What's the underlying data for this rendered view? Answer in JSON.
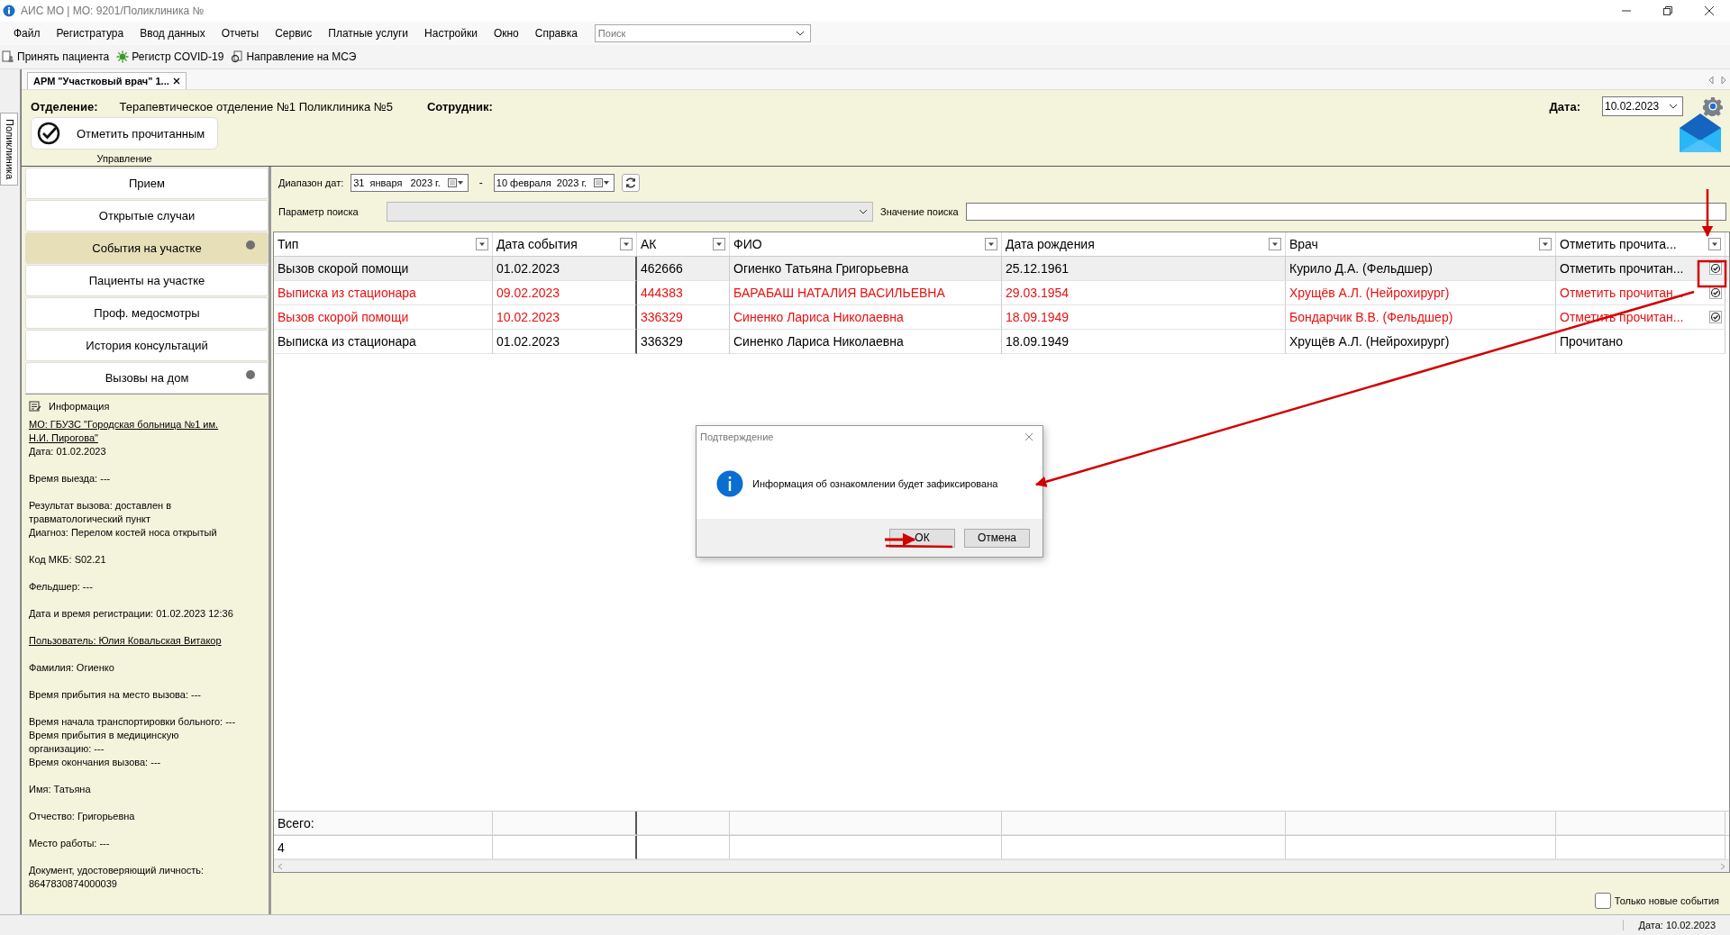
{
  "window": {
    "title": "АИС МО | МО: 9201/Поликлиника №"
  },
  "menu": [
    "Файл",
    "Регистратура",
    "Ввод данных",
    "Отчеты",
    "Сервис",
    "Платные услуги",
    "Настройки",
    "Окно",
    "Справка"
  ],
  "menu_search": {
    "placeholder": "Поиск"
  },
  "toolbar": [
    {
      "label": "Принять пациента",
      "kind": "patient"
    },
    {
      "label": "Регистр COVID-19",
      "kind": "virus"
    },
    {
      "label": "Направление на МСЭ",
      "kind": "referral"
    }
  ],
  "side_tab": "Поликлиника",
  "doc_tab": {
    "label": "АРМ \"Участковый врач\" 1...",
    "selected": true
  },
  "header": {
    "department_label": "Отделение:",
    "department": "Терапевтическое отделение №1 Поликлиника №5",
    "employee_label": "Сотрудник:",
    "date_label": "Дата:",
    "date": "10.02.2023",
    "mark_read_button": "Отметить прочитанным",
    "group_label": "Управление"
  },
  "sidebar": {
    "items": [
      {
        "label": "Прием",
        "selected": false,
        "dot": false
      },
      {
        "label": "Открытые случаи",
        "selected": false,
        "dot": false
      },
      {
        "label": "События на участке",
        "selected": true,
        "dot": true
      },
      {
        "label": "Пациенты на участке",
        "selected": false,
        "dot": false
      },
      {
        "label": "Проф. медосмотры",
        "selected": false,
        "dot": false
      },
      {
        "label": "История консультаций",
        "selected": false,
        "dot": false
      },
      {
        "label": "Вызовы на дом",
        "selected": false,
        "dot": true
      }
    ]
  },
  "info": {
    "title": "Информация",
    "blocks": [
      [
        {
          "text": "МО: ГБУЗС \"Городская больница №1 им. Н.И. Пирогова\"",
          "link": true
        },
        {
          "text": "Дата: 01.02.2023",
          "link": false
        }
      ],
      [
        {
          "text": "Время выезда: ---",
          "link": false
        }
      ],
      [
        {
          "text": "Результат вызова: доставлен в травматологический пункт",
          "link": false
        },
        {
          "text": "Диагноз: Перелом костей носа открытый",
          "link": false
        }
      ],
      [
        {
          "text": "Код МКБ: S02.21",
          "link": false
        }
      ],
      [
        {
          "text": "Фельдшер: ---",
          "link": false
        }
      ],
      [
        {
          "text": "Дата и время регистрации: 01.02.2023 12:36",
          "link": false
        }
      ],
      [
        {
          "text": "Пользователь: Юлия Ковальская Витакор",
          "link": true
        }
      ],
      [
        {
          "text": "Фамилия: Огиенко",
          "link": false
        }
      ],
      [
        {
          "text": "Время прибытия на место вызова: ---",
          "link": false
        }
      ],
      [
        {
          "text": "Время начала транспортировки больного: ---",
          "link": false
        },
        {
          "text": "Время прибытия в медицинскую организацию: ---",
          "link": false
        },
        {
          "text": "Время окончания вызова: ---",
          "link": false
        }
      ],
      [
        {
          "text": "Имя: Татьяна",
          "link": false
        }
      ],
      [
        {
          "text": "Отчество: Григорьевна",
          "link": false
        }
      ],
      [
        {
          "text": "Место работы: ---",
          "link": false
        }
      ],
      [
        {
          "text": "Документ, удостоверяющий личность: 8647830874000039",
          "link": false
        }
      ]
    ]
  },
  "filters": {
    "date_range_label": "Диапазон дат:",
    "date_from": "31  января   2023 г.",
    "date_separator": "-",
    "date_to": "10 февраля  2023 г.",
    "search_param_label": "Параметр поиска",
    "search_value_label": "Значение поиска"
  },
  "table": {
    "columns": [
      "Тип",
      "Дата события",
      "АК",
      "ФИО",
      "Дата рождения",
      "Врач",
      "Отметить  прочита..."
    ],
    "rows": [
      {
        "cells": [
          "Вызов скорой помощи",
          "01.02.2023",
          "462666",
          "Огиенко Татьяна Григорьевна",
          "25.12.1961",
          "Курило Д.А. (Фельдшер)",
          "Отметить  прочитан..."
        ],
        "selected": true,
        "read": false
      },
      {
        "cells": [
          "Выписка из стационара",
          "09.02.2023",
          "444383",
          "БАРАБАШ НАТАЛИЯ ВАСИЛЬЕВНА",
          "29.03.1954",
          "Хрущёв А.Л. (Нейрохирург)",
          "Отметить  прочитан..."
        ],
        "selected": false,
        "read": false
      },
      {
        "cells": [
          "Вызов скорой помощи",
          "10.02.2023",
          "336329",
          "Синенко Лариса Николаевна",
          "18.09.1949",
          "Бондарчик В.В. (Фельдшер)",
          "Отметить  прочитан..."
        ],
        "selected": false,
        "read": false
      },
      {
        "cells": [
          "Выписка из стационара",
          "01.02.2023",
          "336329",
          "Синенко Лариса Николаевна",
          "18.09.1949",
          "Хрущёв А.Л. (Нейрохирург)",
          "Прочитано"
        ],
        "selected": false,
        "read": true
      }
    ],
    "total_label": "Всего:",
    "total": "4"
  },
  "only_new": {
    "label": "Только новые события",
    "checked": false
  },
  "status_bar": {
    "date": "Дата: 10.02.2023"
  },
  "dialog": {
    "title": "Подтверждение",
    "message": "Информация об ознакомлении будет зафиксирована",
    "buttons": [
      "ОК",
      "Отмена"
    ]
  }
}
